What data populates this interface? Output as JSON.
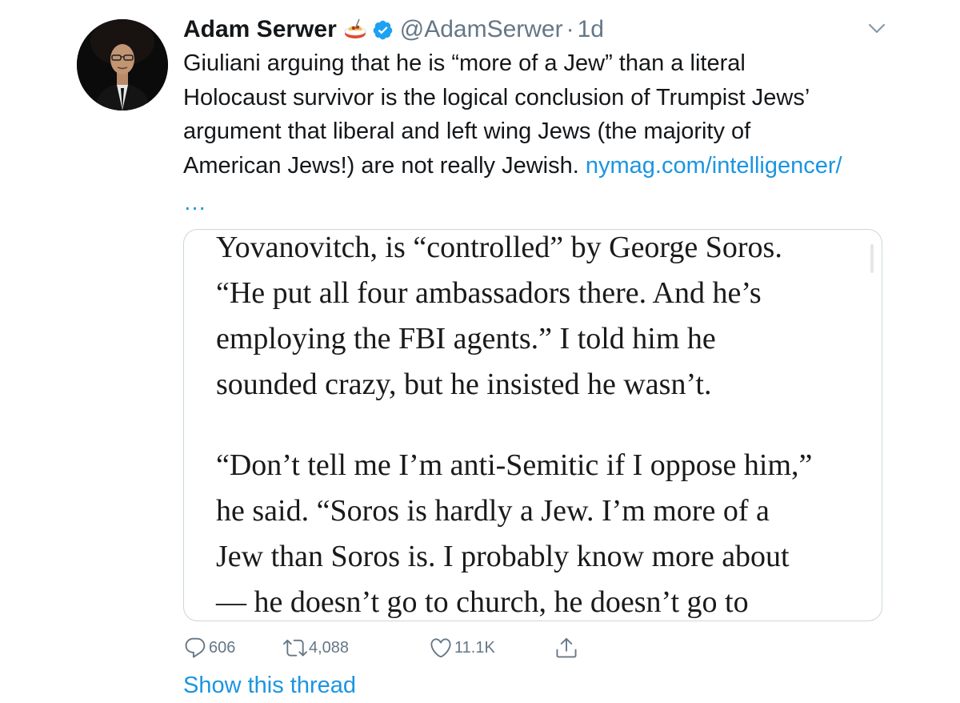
{
  "author": {
    "display_name": "Adam Serwer",
    "emoji_icon": "spaghetti-icon",
    "verified_icon": "verified-badge-icon",
    "handle": "@AdamSerwer",
    "separator": "·",
    "time": "1d"
  },
  "tweet": {
    "text_lines": [
      "Giuliani arguing that he is “more of a Jew” than a literal",
      "Holocaust survivor is the logical conclusion of Trumpist Jews’",
      "argument that liberal and left wing Jews (the majority of",
      "American Jews!) are not really Jewish. "
    ],
    "link_text": "nymag.com/intelligencer/",
    "link_ellipsis": "…"
  },
  "media": {
    "paragraph1": [
      "Yovanovitch, is “controlled” by George Soros.",
      "“He put all four ambassadors there. And he’s",
      "employing the FBI agents.” I told him he",
      "sounded crazy, but he insisted he wasn’t."
    ],
    "paragraph2": [
      "“Don’t tell me I’m anti-Semitic if I oppose him,”",
      "he said. “Soros is hardly a Jew. I’m more of a",
      "Jew than Soros is. I probably know more about",
      "— he doesn’t go to church, he doesn’t go to"
    ]
  },
  "actions": {
    "reply_icon": "reply-icon",
    "reply_count": "606",
    "retweet_icon": "retweet-icon",
    "retweet_count": "4,088",
    "like_icon": "heart-icon",
    "like_count": "11.1K",
    "share_icon": "share-icon"
  },
  "show_thread_label": "Show this thread",
  "colors": {
    "link_blue": "#1b95e0",
    "secondary_gray": "#657786",
    "text_black": "#14171a",
    "card_border": "#ccd6dd"
  }
}
